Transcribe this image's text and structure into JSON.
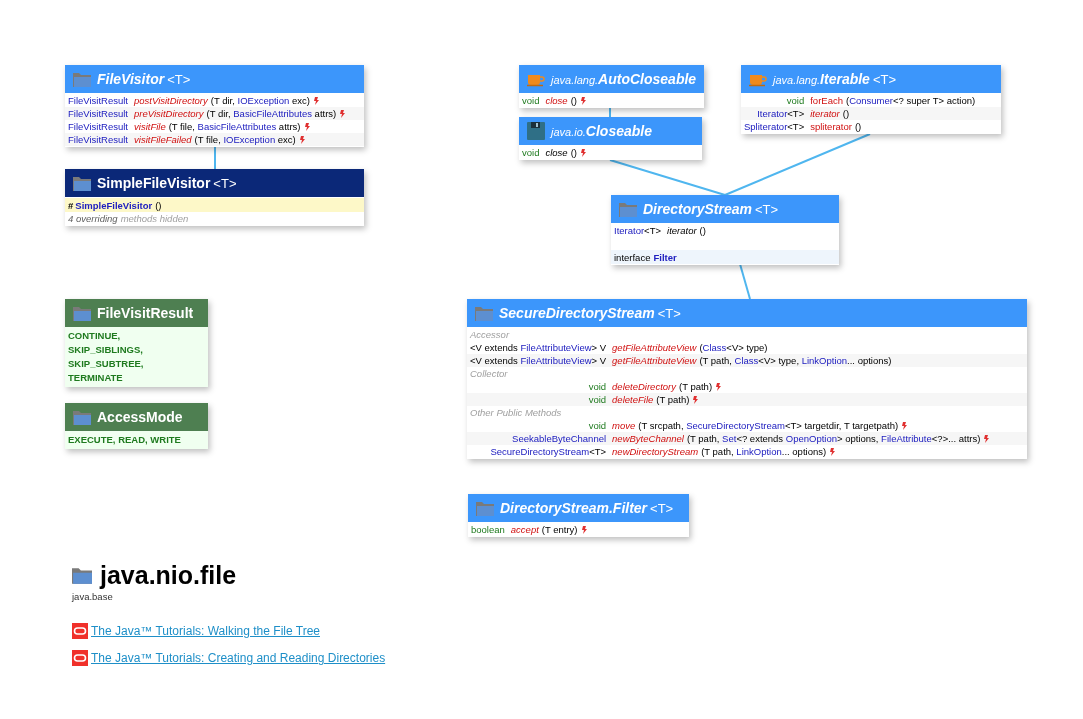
{
  "types": [
    {
      "kind": "interface",
      "name": "FileVisitor",
      "generic": "<T>",
      "members": [
        {
          "kind": "abstract",
          "returns": [
            {
              "text": "FileVisitResult",
              "kind": "type"
            }
          ],
          "name": "postVisitDirectory",
          "params": [
            {
              "text": "(T dir, ",
              "kind": "plain"
            },
            {
              "text": "IOException",
              "kind": "type"
            },
            {
              "text": " exc)",
              "kind": "plain"
            }
          ],
          "throws": true
        },
        {
          "kind": "abstract",
          "returns": [
            {
              "text": "FileVisitResult",
              "kind": "type"
            }
          ],
          "name": "preVisitDirectory",
          "params": [
            {
              "text": "(T dir, ",
              "kind": "plain"
            },
            {
              "text": "BasicFileAttributes",
              "kind": "type"
            },
            {
              "text": " attrs)",
              "kind": "plain"
            }
          ],
          "throws": true
        },
        {
          "kind": "abstract",
          "returns": [
            {
              "text": "FileVisitResult",
              "kind": "type"
            }
          ],
          "name": "visitFile",
          "params": [
            {
              "text": "(T file, ",
              "kind": "plain"
            },
            {
              "text": "BasicFileAttributes",
              "kind": "type"
            },
            {
              "text": " attrs)",
              "kind": "plain"
            }
          ],
          "throws": true
        },
        {
          "kind": "abstract",
          "returns": [
            {
              "text": "FileVisitResult",
              "kind": "type"
            }
          ],
          "name": "visitFileFailed",
          "params": [
            {
              "text": "(T file, ",
              "kind": "plain"
            },
            {
              "text": "IOException",
              "kind": "type"
            },
            {
              "text": " exc)",
              "kind": "plain"
            }
          ],
          "throws": true
        }
      ]
    },
    {
      "kind": "class",
      "name": "SimpleFileVisitor",
      "generic": "<T>",
      "members": [
        {
          "kind": "constructor",
          "marker": "#",
          "name": "SimpleFileVisitor",
          "params": [
            {
              "text": "()",
              "kind": "plain"
            }
          ]
        },
        {
          "kind": "note",
          "count": "4 overriding",
          "rest": "methods hidden"
        }
      ]
    },
    {
      "kind": "interface",
      "prefix": "java.lang.",
      "name": "AutoCloseable",
      "members": [
        {
          "kind": "abstract",
          "returns": [
            {
              "text": "void",
              "kind": "primitive"
            }
          ],
          "name": "close",
          "params": [
            {
              "text": "()",
              "kind": "plain"
            }
          ],
          "throws": true
        }
      ]
    },
    {
      "kind": "interface",
      "prefix": "java.io.",
      "name": "Closeable",
      "members": [
        {
          "kind": "inherited",
          "returns": [
            {
              "text": "void",
              "kind": "primitive"
            }
          ],
          "name": "close",
          "params": [
            {
              "text": "()",
              "kind": "plain"
            }
          ],
          "throws": true
        }
      ]
    },
    {
      "kind": "interface",
      "prefix": "java.lang.",
      "name": "Iterable",
      "generic": "<T>",
      "members": [
        {
          "kind": "default",
          "returns": [
            {
              "text": "void",
              "kind": "primitive"
            }
          ],
          "name": "forEach",
          "params": [
            {
              "text": "(",
              "kind": "plain"
            },
            {
              "text": "Consumer",
              "kind": "type"
            },
            {
              "text": "<? super T> action)",
              "kind": "plain"
            }
          ],
          "throws": false
        },
        {
          "kind": "abstract",
          "returns": [
            {
              "text": "Iterator",
              "kind": "type"
            },
            {
              "text": "<T>",
              "kind": "plain"
            }
          ],
          "name": "iterator",
          "params": [
            {
              "text": "()",
              "kind": "plain"
            }
          ],
          "throws": false
        },
        {
          "kind": "default",
          "returns": [
            {
              "text": "Spliterator",
              "kind": "type"
            },
            {
              "text": "<T>",
              "kind": "plain"
            }
          ],
          "name": "spliterator",
          "params": [
            {
              "text": "()",
              "kind": "plain"
            }
          ],
          "throws": false
        }
      ]
    },
    {
      "kind": "interface",
      "name": "DirectoryStream",
      "generic": "<T>",
      "members": [
        {
          "kind": "inherited",
          "returns": [
            {
              "text": "Iterator",
              "kind": "type"
            },
            {
              "text": "<T>",
              "kind": "plain"
            }
          ],
          "name": "iterator",
          "params": [
            {
              "text": "()",
              "kind": "plain"
            }
          ],
          "throws": false
        },
        {
          "kind": "gap"
        },
        {
          "kind": "nested",
          "prefix": "interface",
          "name": "Filter"
        }
      ]
    },
    {
      "kind": "enum",
      "name": "FileVisitResult",
      "members": [
        {
          "kind": "constants",
          "lines": [
            "CONTINUE,",
            "SKIP_SIBLINGS,",
            "SKIP_SUBTREE,",
            "TERMINATE"
          ]
        }
      ]
    },
    {
      "kind": "enum",
      "name": "AccessMode",
      "members": [
        {
          "kind": "constants",
          "lines": [
            "EXECUTE, READ, WRITE"
          ]
        }
      ]
    },
    {
      "kind": "interface",
      "name": "SecureDirectoryStream",
      "generic": "<T>",
      "members": [
        {
          "kind": "group",
          "label": "Accessor"
        },
        {
          "kind": "abstract",
          "returns": [
            {
              "text": "<V extends ",
              "kind": "plain"
            },
            {
              "text": "FileAttributeView",
              "kind": "type"
            },
            {
              "text": "> V",
              "kind": "plain"
            }
          ],
          "name": "getFileAttributeView",
          "params": [
            {
              "text": "(",
              "kind": "plain"
            },
            {
              "text": "Class",
              "kind": "type"
            },
            {
              "text": "<V> type)",
              "kind": "plain"
            }
          ],
          "throws": false
        },
        {
          "kind": "abstract",
          "returns": [
            {
              "text": "<V extends ",
              "kind": "plain"
            },
            {
              "text": "FileAttributeView",
              "kind": "type"
            },
            {
              "text": "> V",
              "kind": "plain"
            }
          ],
          "name": "getFileAttributeView",
          "params": [
            {
              "text": "(T path, ",
              "kind": "plain"
            },
            {
              "text": "Class",
              "kind": "type"
            },
            {
              "text": "<V> type, ",
              "kind": "plain"
            },
            {
              "text": "LinkOption",
              "kind": "type"
            },
            {
              "text": "... options)",
              "kind": "plain"
            }
          ],
          "throws": false
        },
        {
          "kind": "group",
          "label": "Collector"
        },
        {
          "kind": "abstract",
          "returns": [
            {
              "text": "void",
              "kind": "primitive"
            }
          ],
          "name": "deleteDirectory",
          "params": [
            {
              "text": "(T path)",
              "kind": "plain"
            }
          ],
          "throws": true
        },
        {
          "kind": "abstract",
          "returns": [
            {
              "text": "void",
              "kind": "primitive"
            }
          ],
          "name": "deleteFile",
          "params": [
            {
              "text": "(T path)",
              "kind": "plain"
            }
          ],
          "throws": true
        },
        {
          "kind": "group",
          "label": "Other Public Methods"
        },
        {
          "kind": "abstract",
          "returns": [
            {
              "text": "void",
              "kind": "primitive"
            }
          ],
          "name": "move",
          "params": [
            {
              "text": "(T srcpath, ",
              "kind": "plain"
            },
            {
              "text": "SecureDirectoryStream",
              "kind": "type"
            },
            {
              "text": "<T> targetdir, T targetpath)",
              "kind": "plain"
            }
          ],
          "throws": true
        },
        {
          "kind": "abstract",
          "returns": [
            {
              "text": "SeekableByteChannel",
              "kind": "type"
            }
          ],
          "name": "newByteChannel",
          "params": [
            {
              "text": "(T path, ",
              "kind": "plain"
            },
            {
              "text": "Set",
              "kind": "type"
            },
            {
              "text": "<? extends ",
              "kind": "plain"
            },
            {
              "text": "OpenOption",
              "kind": "type"
            },
            {
              "text": "> options, ",
              "kind": "plain"
            },
            {
              "text": "FileAttribute",
              "kind": "type"
            },
            {
              "text": "<?>... attrs)",
              "kind": "plain"
            }
          ],
          "throws": true
        },
        {
          "kind": "abstract",
          "returns": [
            {
              "text": "SecureDirectoryStream",
              "kind": "type"
            },
            {
              "text": "<T>",
              "kind": "plain"
            }
          ],
          "name": "newDirectoryStream",
          "params": [
            {
              "text": "(T path, ",
              "kind": "plain"
            },
            {
              "text": "LinkOption",
              "kind": "type"
            },
            {
              "text": "... options)",
              "kind": "plain"
            }
          ],
          "throws": true
        }
      ]
    },
    {
      "kind": "interface",
      "name": "DirectoryStream.Filter",
      "generic": "<T>",
      "members": [
        {
          "kind": "abstract",
          "returns": [
            {
              "text": "boolean",
              "kind": "primitive"
            }
          ],
          "name": "accept",
          "params": [
            {
              "text": "(T entry)",
              "kind": "plain"
            }
          ],
          "throws": true
        }
      ]
    }
  ],
  "package": {
    "name": "java.nio.file",
    "module": "java.base"
  },
  "links": [
    {
      "text": "The Java™ Tutorials: Walking the File Tree"
    },
    {
      "text": "The Java™ Tutorials: Creating and Reading Directories"
    }
  ]
}
